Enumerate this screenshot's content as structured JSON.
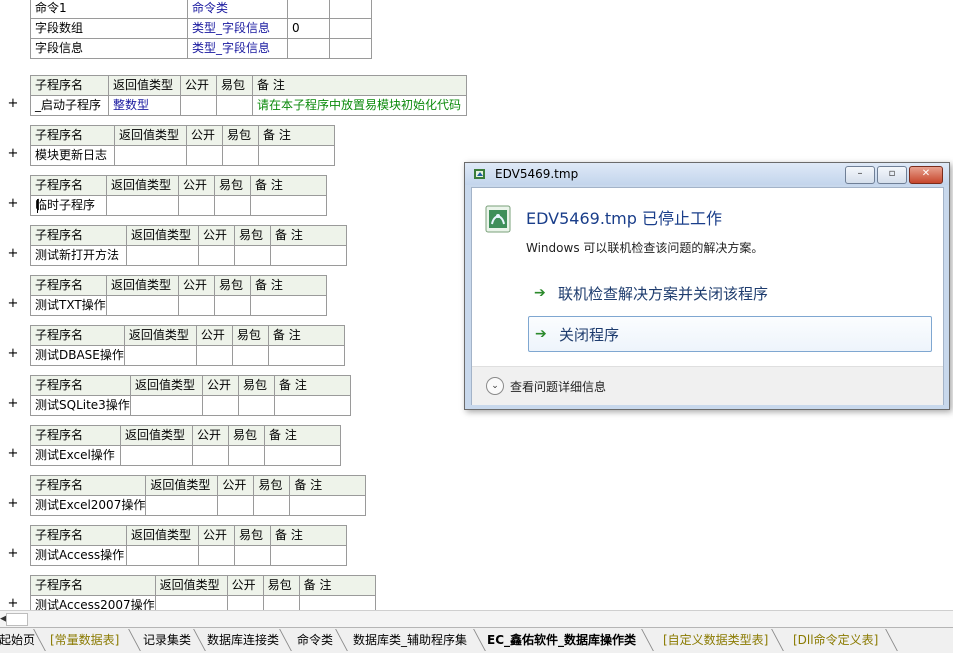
{
  "top_rows": [
    {
      "name": "命令1",
      "type": "命令类",
      "extra": ""
    },
    {
      "name": "字段数组",
      "type": "类型_字段信息",
      "extra": "0"
    },
    {
      "name": "字段信息",
      "type": "类型_字段信息",
      "extra": ""
    }
  ],
  "headers": {
    "name": "子程序名",
    "ret": "返回值类型",
    "pub": "公开",
    "easy": "易包",
    "note": "备 注"
  },
  "subs": [
    {
      "name": "_启动子程序",
      "ret": "整数型",
      "note": "请在本子程序中放置易模块初始化代码"
    },
    {
      "name": "模块更新日志",
      "ret": "",
      "note": ""
    },
    {
      "name": "临时子程序",
      "ret": "",
      "note": ""
    },
    {
      "name": "测试新打开方法",
      "ret": "",
      "note": ""
    },
    {
      "name": "测试TXT操作",
      "ret": "",
      "note": ""
    },
    {
      "name": "测试DBASE操作",
      "ret": "",
      "note": ""
    },
    {
      "name": "测试SQLite3操作",
      "ret": "",
      "note": ""
    },
    {
      "name": "测试Excel操作",
      "ret": "",
      "note": ""
    },
    {
      "name": "测试Excel2007操作",
      "ret": "",
      "note": ""
    },
    {
      "name": "测试Access操作",
      "ret": "",
      "note": ""
    },
    {
      "name": "测试Access2007操作",
      "ret": "",
      "note": ""
    }
  ],
  "plus": "+",
  "tabs": [
    {
      "label": "起始页",
      "style": "normal"
    },
    {
      "label": "[常量数据表]",
      "style": "yellow"
    },
    {
      "label": "记录集类",
      "style": "normal"
    },
    {
      "label": "数据库连接类",
      "style": "normal"
    },
    {
      "label": "命令类",
      "style": "normal"
    },
    {
      "label": "数据库类_辅助程序集",
      "style": "normal"
    },
    {
      "label": "EC_鑫佑软件_数据库操作类",
      "style": "active"
    },
    {
      "label": "[自定义数据类型表]",
      "style": "yellow"
    },
    {
      "label": "[Dll命令定义表]",
      "style": "yellow"
    }
  ],
  "dialog": {
    "title": "EDV5469.tmp",
    "heading": "EDV5469.tmp 已停止工作",
    "subtext": "Windows 可以联机检查该问题的解决方案。",
    "option1": "联机检查解决方案并关闭该程序",
    "option2": "关闭程序",
    "footer": "查看问题详细信息",
    "btn_min": "–",
    "btn_max": "▫",
    "btn_close": "✕",
    "arrow": "➔",
    "chev": "⌄"
  }
}
